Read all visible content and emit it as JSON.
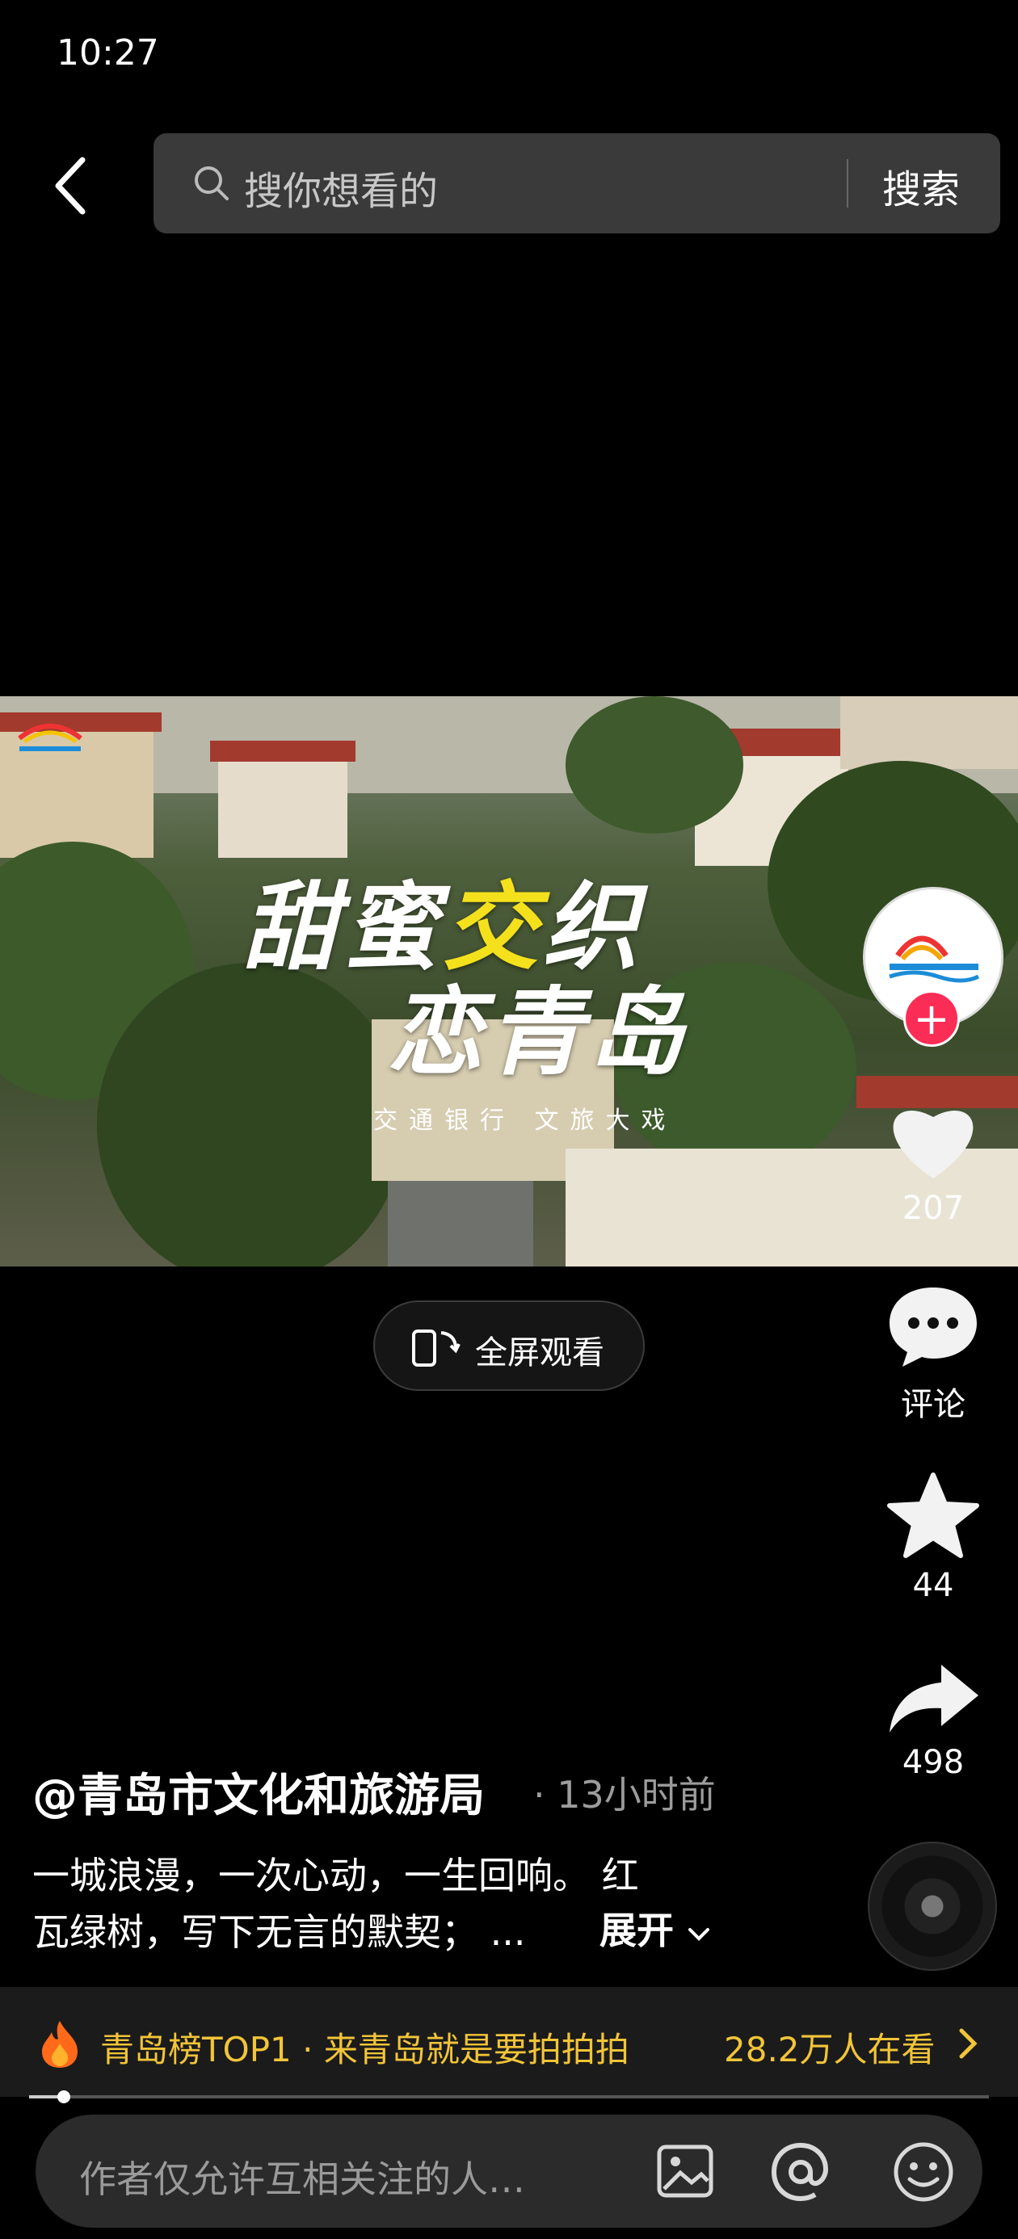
{
  "status_bar": {
    "time": "10:27"
  },
  "search": {
    "placeholder": "搜你想看的",
    "button_label": "搜索"
  },
  "video": {
    "title_part1": "甜蜜",
    "title_highlight": "交",
    "title_part2": "织",
    "title_line2": "恋青岛",
    "subtitle": "交通银行 文旅大戏",
    "progress_fraction": 0.036
  },
  "actions": {
    "like_count": "207",
    "comment_label": "评论",
    "favorite_count": "44",
    "share_count": "498"
  },
  "fullscreen": {
    "label": "全屏观看"
  },
  "post": {
    "author": "@青岛市文化和旅游局",
    "time": "· 13小时前",
    "description_line1": "一城浪漫，一次心动，一生回响。 红",
    "description_line2": "瓦绿树，写下无言的默契； ...",
    "expand_label": "展开"
  },
  "hot_banner": {
    "title": "青岛榜TOP1 · 来青岛就是要拍拍拍",
    "viewers": "28.2万人在看"
  },
  "comment_bar": {
    "placeholder": "作者仅允许互相关注的人…"
  }
}
